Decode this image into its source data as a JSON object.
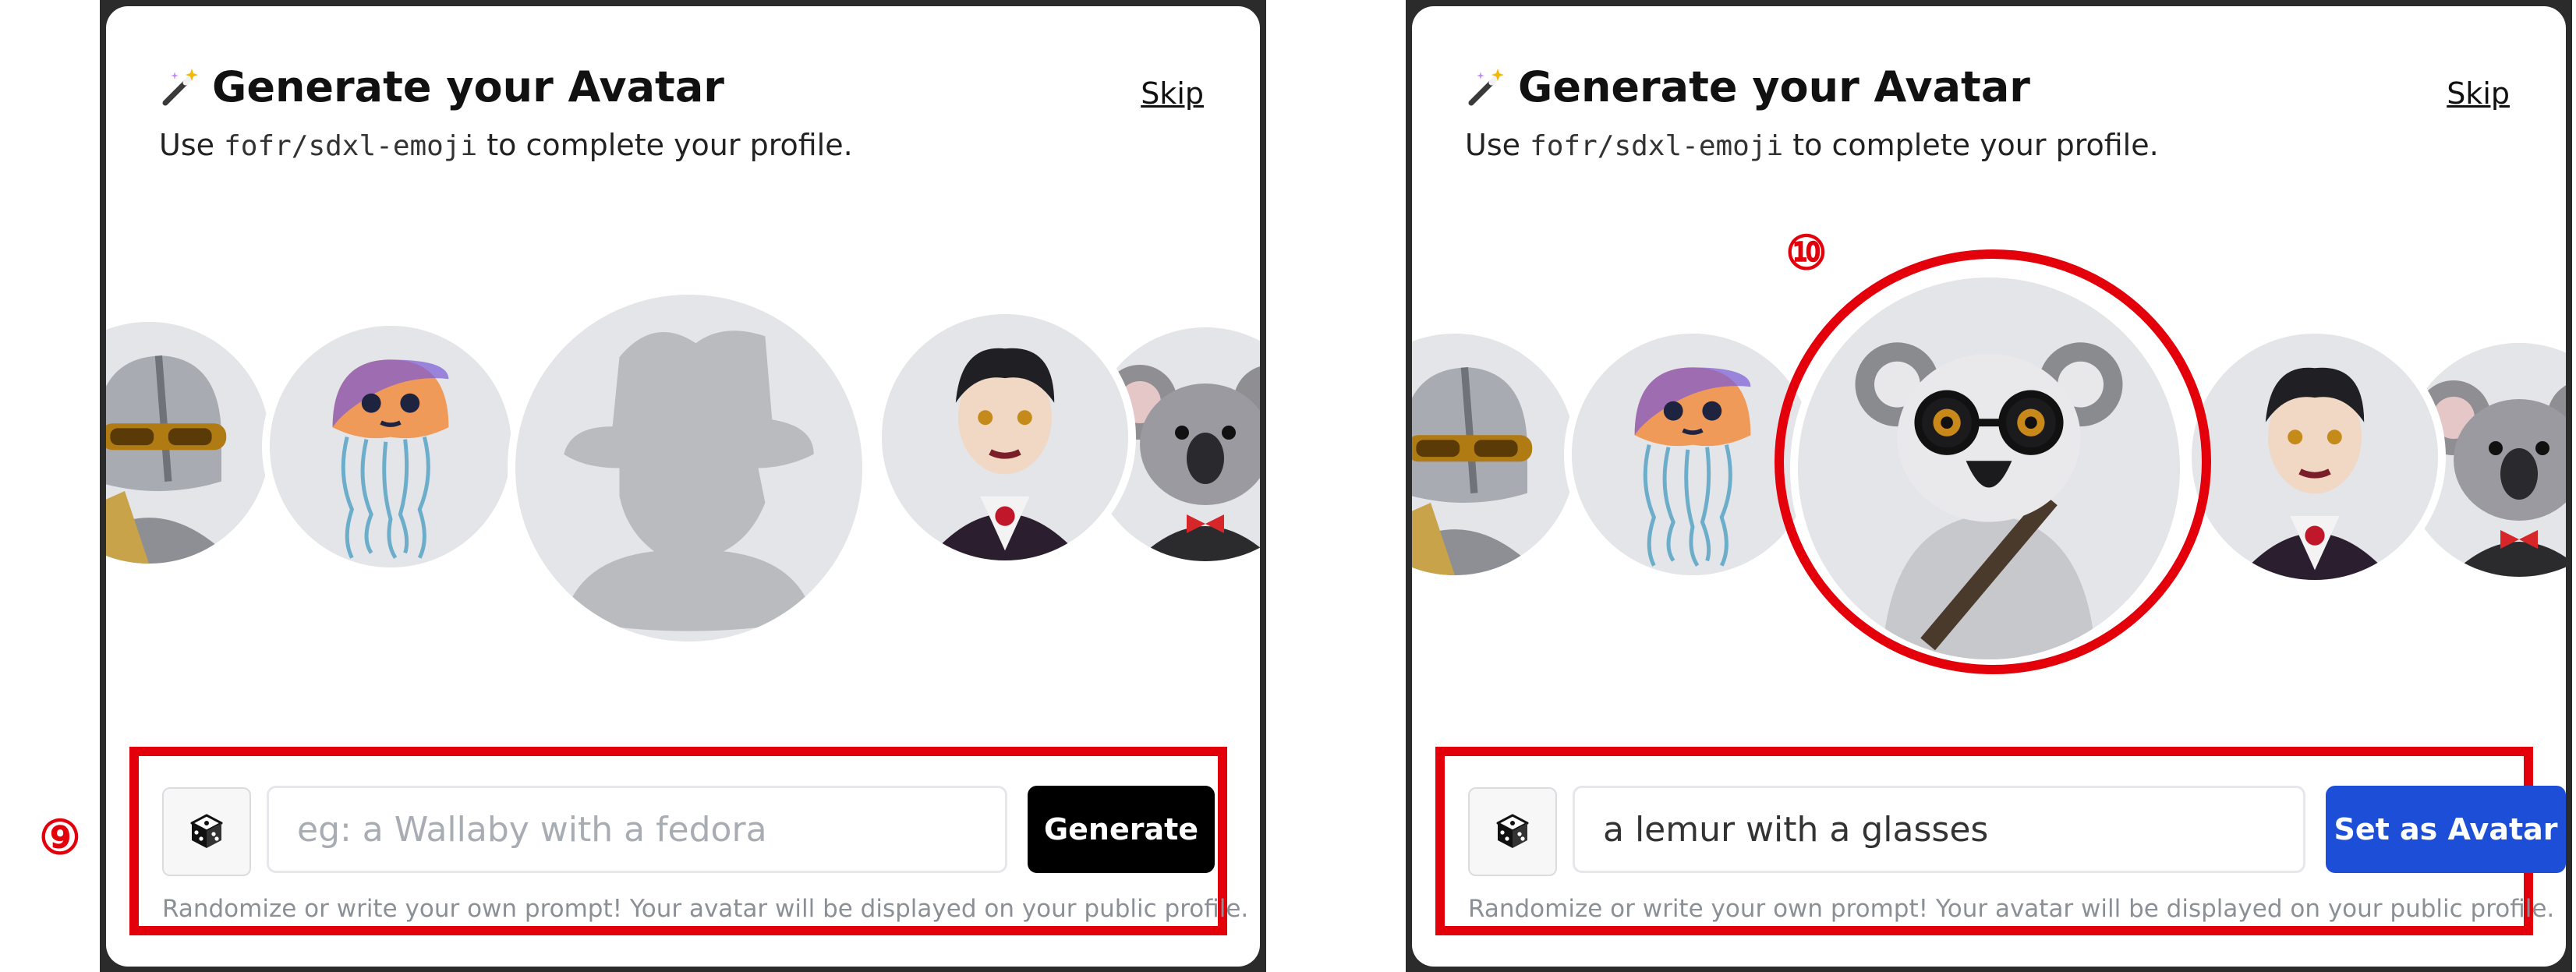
{
  "panels": [
    {
      "title": "Generate your Avatar",
      "subtitle_prefix": "Use ",
      "model": "fofr/sdxl-emoji",
      "subtitle_suffix": " to complete your profile.",
      "skip_label": "Skip",
      "avatars": [
        "knight",
        "jellyfish",
        "placeholder silhouette",
        "vampire",
        "koala"
      ],
      "input": {
        "placeholder": "eg: a Wallaby with a fedora",
        "value": ""
      },
      "button_label": "Generate",
      "help_text": "Randomize or write your own prompt! Your avatar will be displayed on your public profile.",
      "callout": "⑨"
    },
    {
      "title": "Generate your Avatar",
      "subtitle_prefix": "Use ",
      "model": "fofr/sdxl-emoji",
      "subtitle_suffix": " to complete your profile.",
      "skip_label": "Skip",
      "avatars": [
        "knight",
        "jellyfish",
        "lemur with glasses",
        "vampire",
        "koala"
      ],
      "input": {
        "placeholder": "",
        "value": "a lemur with a glasses"
      },
      "button_label": "Set as Avatar",
      "help_text": "Randomize or write your own prompt! Your avatar will be displayed on your public profile.",
      "callout": "⑩"
    }
  ],
  "icons": {
    "title": "magic-wand-icon",
    "randomize": "dice-icon"
  },
  "colors": {
    "annotation": "#e3000b",
    "generate_button": "#000000",
    "set_avatar_button": "#1d4ed8"
  }
}
